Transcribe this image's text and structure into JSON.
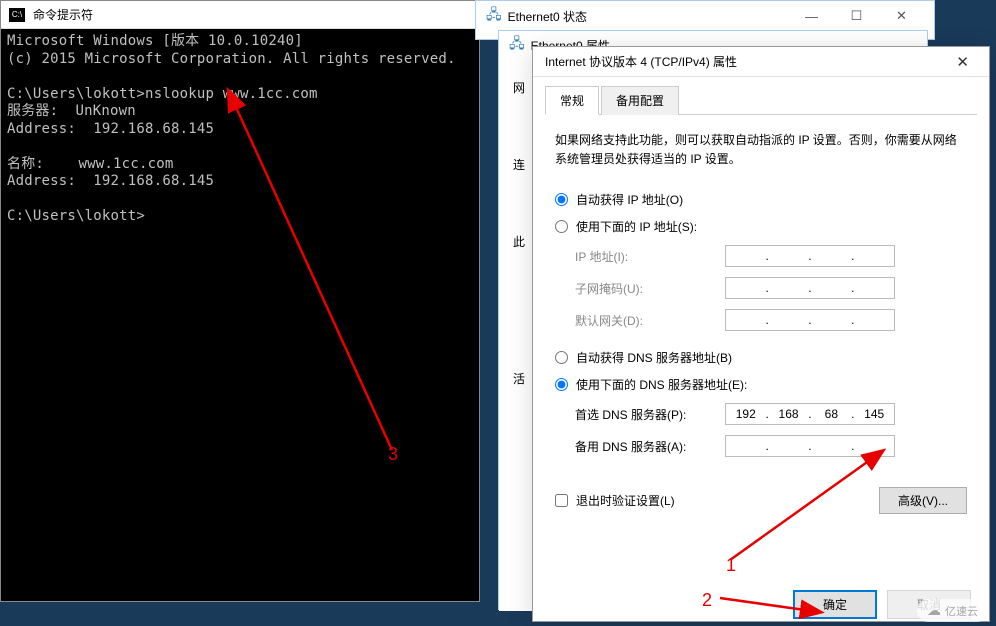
{
  "cmd": {
    "title": "命令提示符",
    "line1": "Microsoft Windows [版本 10.0.10240]",
    "line2": "(c) 2015 Microsoft Corporation. All rights reserved.",
    "prompt1": "C:\\Users\\lokott>nslookup www.1cc.com",
    "server_label": "服务器:  UnKnown",
    "addr1": "Address:  192.168.68.145",
    "name_label": "名称:    www.1cc.com",
    "addr2": "Address:  192.168.68.145",
    "prompt2": "C:\\Users\\lokott>"
  },
  "eth_status": {
    "title": "Ethernet0 状态",
    "icon": "ethernet-icon"
  },
  "eth_props": {
    "title": "Ethernet0 属性",
    "side_labels": {
      "net": "网",
      "conn": "连",
      "this": "此",
      "activity": "活"
    }
  },
  "ipv4": {
    "title": "Internet 协议版本 4 (TCP/IPv4) 属性",
    "tab_general": "常规",
    "tab_alt": "备用配置",
    "info": "如果网络支持此功能，则可以获取自动指派的 IP 设置。否则，你需要从网络系统管理员处获得适当的 IP 设置。",
    "radio_auto_ip": "自动获得 IP 地址(O)",
    "radio_manual_ip": "使用下面的 IP 地址(S):",
    "label_ip": "IP 地址(I):",
    "label_mask": "子网掩码(U):",
    "label_gateway": "默认网关(D):",
    "radio_auto_dns": "自动获得 DNS 服务器地址(B)",
    "radio_manual_dns": "使用下面的 DNS 服务器地址(E):",
    "label_dns1": "首选 DNS 服务器(P):",
    "label_dns2": "备用 DNS 服务器(A):",
    "dns1": {
      "o1": "192",
      "o2": "168",
      "o3": "68",
      "o4": "145"
    },
    "checkbox_validate": "退出时验证设置(L)",
    "btn_advanced": "高级(V)...",
    "btn_ok": "确定",
    "btn_cancel": "取消"
  },
  "annotations": {
    "n1": "1",
    "n2": "2",
    "n3": "3"
  },
  "watermark": "亿速云"
}
